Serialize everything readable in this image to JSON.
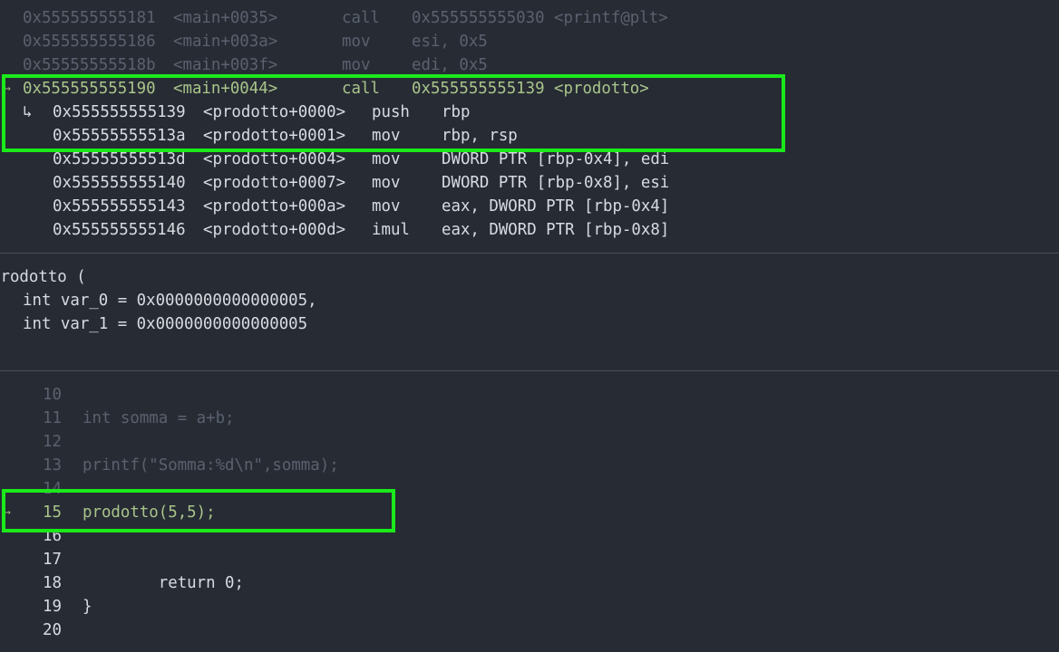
{
  "disassembly": {
    "rows": [
      {
        "marker": "",
        "addr": "0x555555555181",
        "sym": "<main+0035>",
        "op": "call",
        "args": "0x555555555030 <printf@plt>",
        "state": "dim",
        "indent": 0
      },
      {
        "marker": "",
        "addr": "0x555555555186",
        "sym": "<main+003a>",
        "op": "mov",
        "args": "esi, 0x5",
        "state": "dim",
        "indent": 0
      },
      {
        "marker": "",
        "addr": "0x55555555518b",
        "sym": "<main+003f>",
        "op": "mov",
        "args": "edi, 0x5",
        "state": "dim",
        "indent": 0
      },
      {
        "marker": "→",
        "addr": "0x555555555190",
        "sym": "<main+0044>",
        "op": "call",
        "args": "0x555555555139 <prodotto>",
        "state": "cur",
        "indent": 0
      },
      {
        "marker": "↳",
        "addr": "0x555555555139",
        "sym": "<prodotto+0000>",
        "op": "push",
        "args": "rbp",
        "state": "norm",
        "indent": 1
      },
      {
        "marker": "",
        "addr": "0x55555555513a",
        "sym": "<prodotto+0001>",
        "op": "mov",
        "args": "rbp, rsp",
        "state": "norm",
        "indent": 1
      },
      {
        "marker": "",
        "addr": "0x55555555513d",
        "sym": "<prodotto+0004>",
        "op": "mov",
        "args": "DWORD PTR [rbp-0x4], edi",
        "state": "norm",
        "indent": 1
      },
      {
        "marker": "",
        "addr": "0x555555555140",
        "sym": "<prodotto+0007>",
        "op": "mov",
        "args": "DWORD PTR [rbp-0x8], esi",
        "state": "norm",
        "indent": 1
      },
      {
        "marker": "",
        "addr": "0x555555555143",
        "sym": "<prodotto+000a>",
        "op": "mov",
        "args": "eax, DWORD PTR [rbp-0x4]",
        "state": "norm",
        "indent": 1
      },
      {
        "marker": "",
        "addr": "0x555555555146",
        "sym": "<prodotto+000d>",
        "op": "imul",
        "args": "eax, DWORD PTR [rbp-0x8]",
        "state": "norm",
        "indent": 1
      }
    ]
  },
  "args_panel": {
    "header": "prodotto (",
    "args": [
      "int var_0 = 0x0000000000000005,",
      "int var_1 = 0x0000000000000005"
    ]
  },
  "source": {
    "lines": [
      {
        "marker": "",
        "num": "10",
        "code": "",
        "state": "dim"
      },
      {
        "marker": "",
        "num": "11",
        "code": "int somma = a+b;",
        "state": "dim"
      },
      {
        "marker": "",
        "num": "12",
        "code": "",
        "state": "dim"
      },
      {
        "marker": "",
        "num": "13",
        "code": "printf(\"Somma:%d\\n\",somma);",
        "state": "dim"
      },
      {
        "marker": "",
        "num": "14",
        "code": "",
        "state": "dim"
      },
      {
        "marker": "→",
        "num": "15",
        "code": "prodotto(5,5);",
        "state": "cur"
      },
      {
        "marker": "",
        "num": "16",
        "code": "",
        "state": "norm"
      },
      {
        "marker": "",
        "num": "17",
        "code": "",
        "state": "norm"
      },
      {
        "marker": "",
        "num": "18",
        "code": "        return 0;",
        "state": "norm"
      },
      {
        "marker": "",
        "num": "19",
        "code": "}",
        "state": "norm"
      },
      {
        "marker": "",
        "num": "20",
        "code": "",
        "state": "norm"
      }
    ]
  },
  "colors": {
    "background": "#272b34",
    "highlight_box": "#1aea1a",
    "current_line": "#a8c58a",
    "dim_text": "#5a616e",
    "normal_text": "#d8dbe1"
  }
}
